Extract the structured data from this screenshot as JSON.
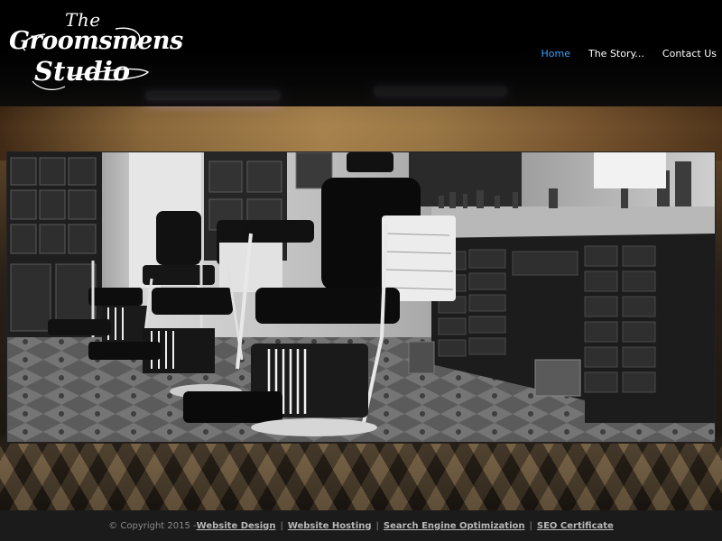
{
  "logo": {
    "line1": "The",
    "line2": "Groomsmens",
    "line3": "Studio"
  },
  "nav": {
    "items": [
      {
        "label": "Home",
        "active": true
      },
      {
        "label": "The Story...",
        "active": false
      },
      {
        "label": "Contact Us",
        "active": false
      }
    ]
  },
  "hero": {
    "image_subject": "black-and-white barber shop with vintage barber chairs and apothecary drawer cabinets"
  },
  "footer": {
    "copyright": "© Copyright 2015 - ",
    "links": [
      "Website Design",
      "Website Hosting",
      "Search Engine Optimization",
      "SEO Certificate"
    ]
  },
  "colors": {
    "nav_active": "#3aa0ff",
    "nav_text": "#ffffff",
    "footer_bg": "#1b1b1b",
    "header_bg": "#000000"
  }
}
